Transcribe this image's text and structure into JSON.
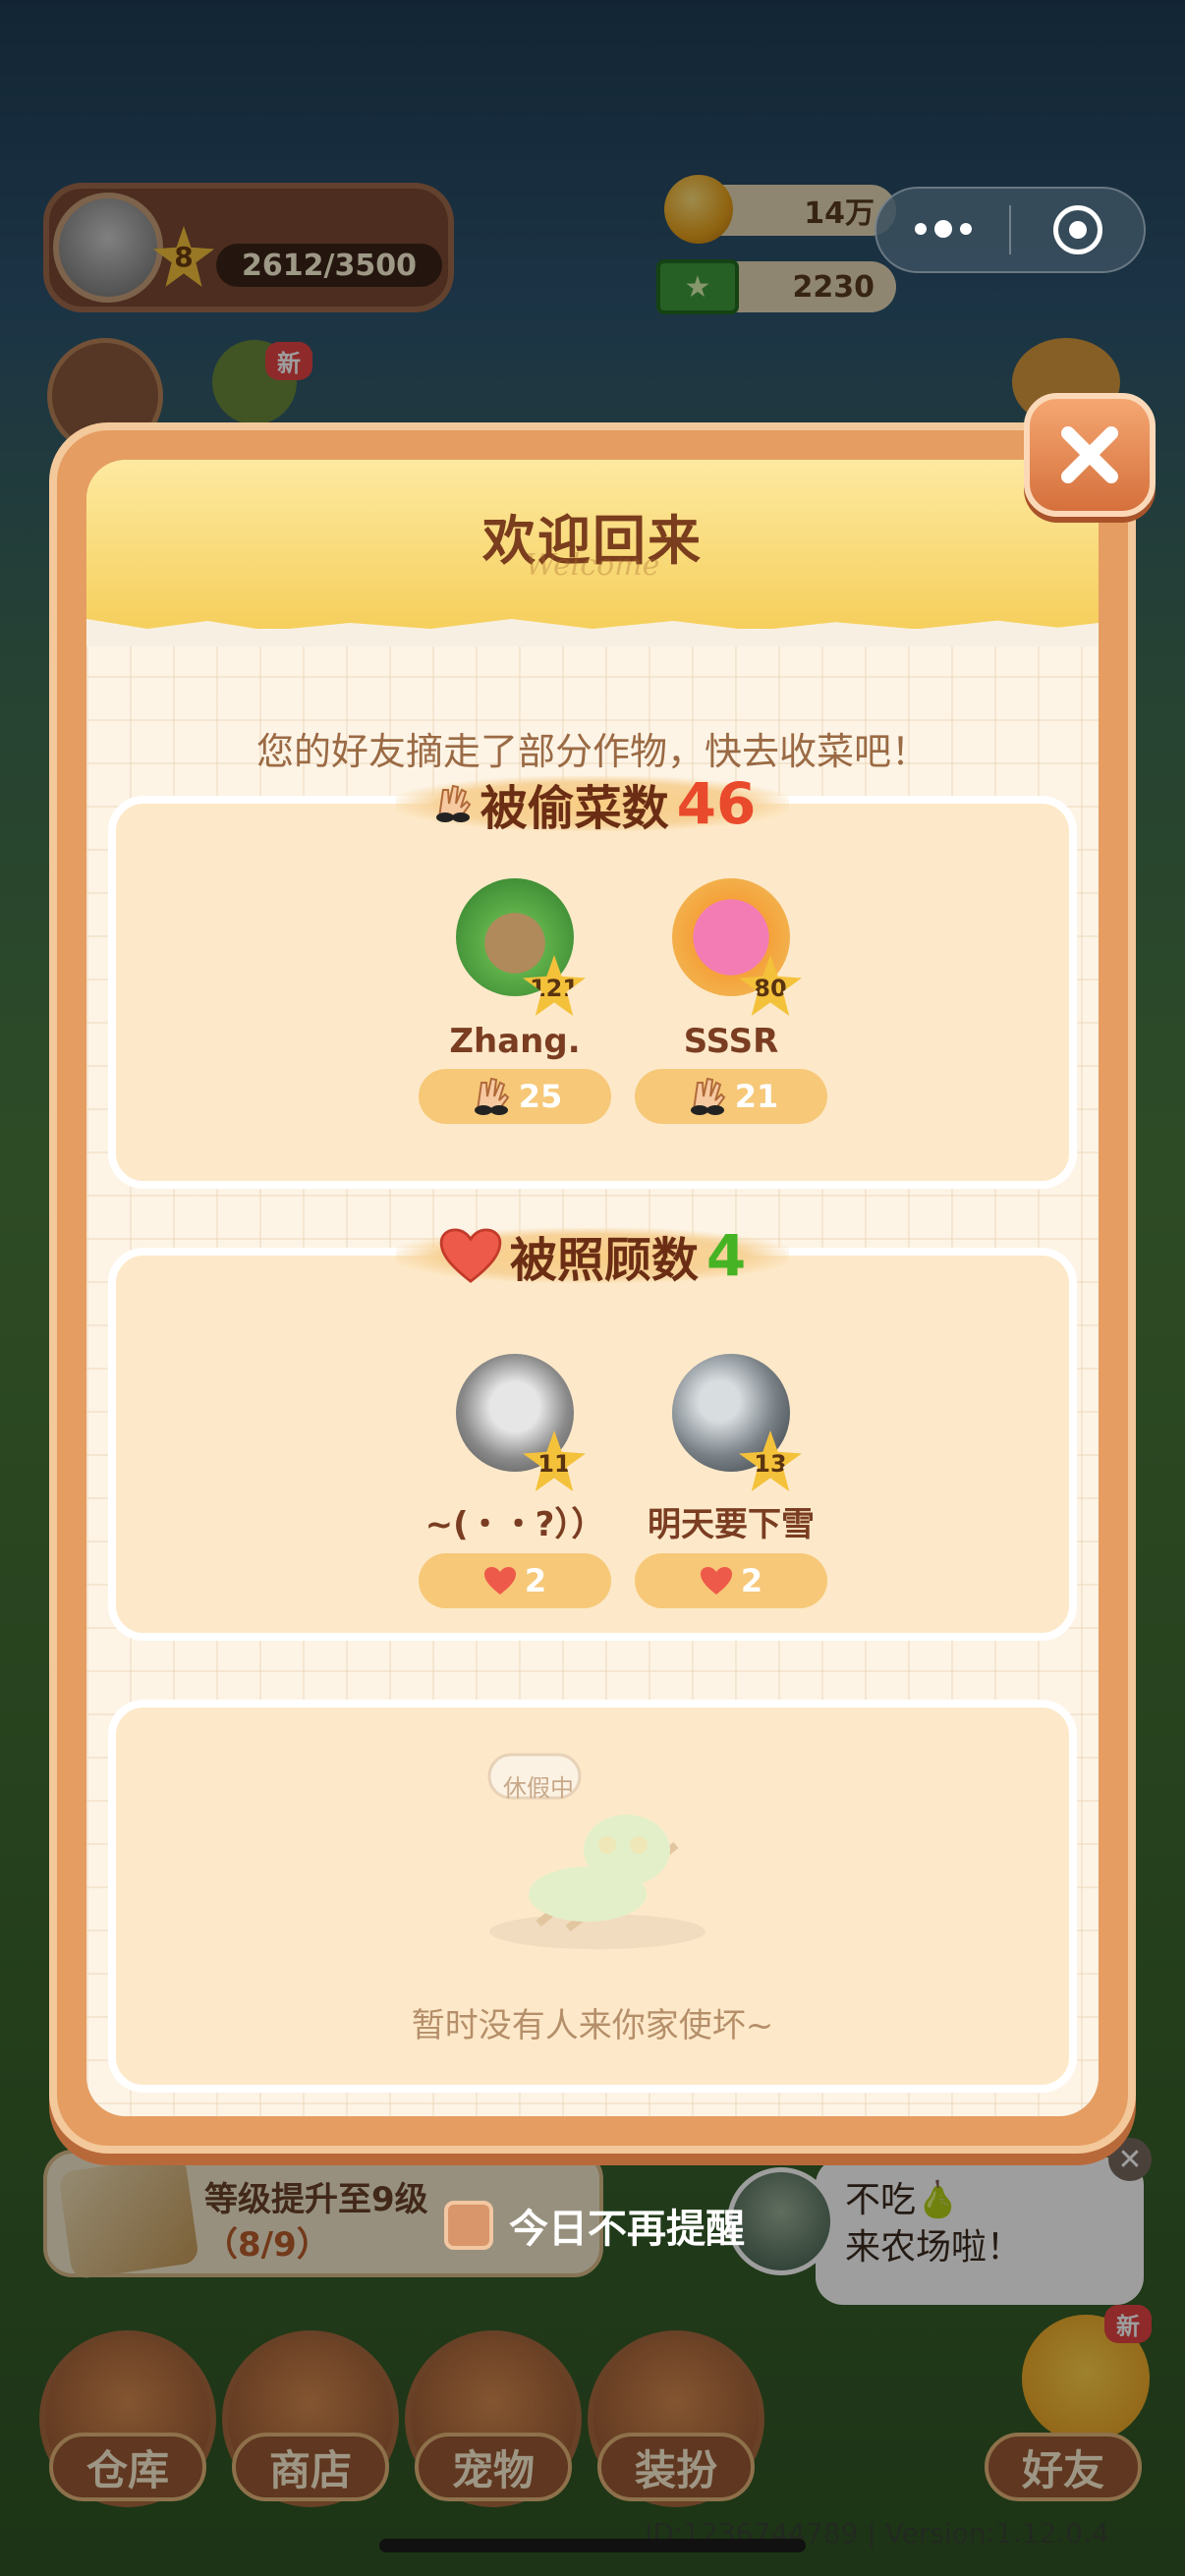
{
  "hud": {
    "level": "8",
    "xp": "2612/3500",
    "coins": "14万",
    "cash": "2230",
    "new_badge": "新"
  },
  "modal": {
    "title": "欢迎回来",
    "title_sub": "Welcome",
    "subtitle": "您的好友摘走了部分作物，快去收菜吧！",
    "stolen": {
      "title": "被偷菜数",
      "count": "46",
      "people": [
        {
          "name": "Zhang.",
          "level": "121",
          "count": "25"
        },
        {
          "name": "SSSR",
          "level": "80",
          "count": "21"
        }
      ]
    },
    "cared": {
      "title": "被照顾数",
      "count": "4",
      "people": [
        {
          "name": "~(・・?））",
          "level": "11",
          "count": "2"
        },
        {
          "name": "明天要下雪",
          "level": "13",
          "count": "2"
        }
      ]
    },
    "empty": {
      "badge": "休假中",
      "note": "暂时没有人来你家使坏~"
    },
    "dont_remind": "今日不再提醒"
  },
  "bottom": {
    "level_card_title": "等级提升至9级",
    "level_card_progress": "（8/9）",
    "chat_line1": "不吃🍐",
    "chat_line2": "来农场啦！",
    "buttons": [
      "仓库",
      "商店",
      "宠物",
      "装扮",
      "好友"
    ],
    "new_badge": "新",
    "footer": "ID:1236744789  |  Version:1.12.0.4"
  },
  "colors": {
    "accent": "#e59d62",
    "red_count": "#e94a2c",
    "green_count": "#46b324"
  }
}
